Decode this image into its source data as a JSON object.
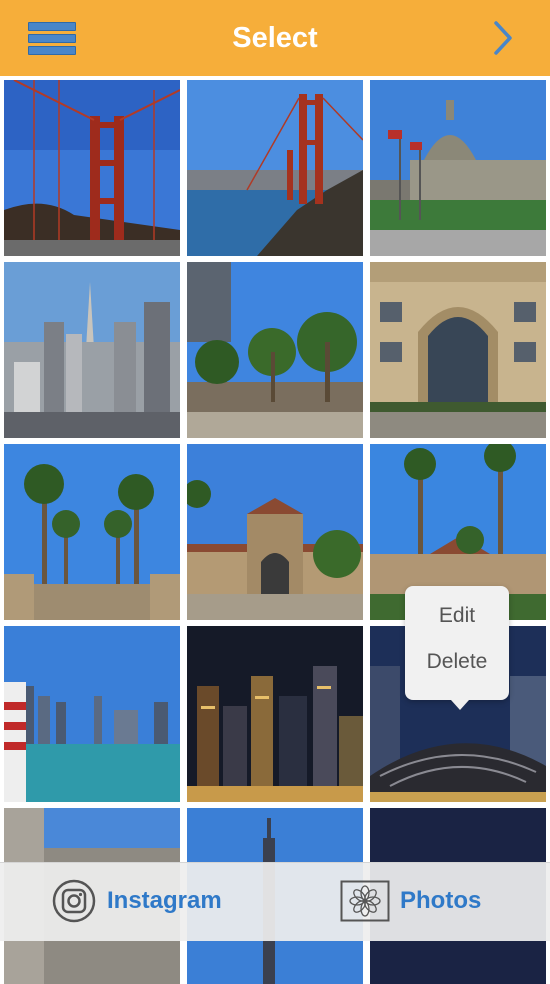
{
  "header": {
    "title": "Select",
    "menu_icon": "menu-icon",
    "next_icon": "chevron-right-icon"
  },
  "grid": {
    "photos": [
      {
        "subject": "golden-gate-bridge-tower"
      },
      {
        "subject": "golden-gate-bridge-bay"
      },
      {
        "subject": "city-hall-dome"
      },
      {
        "subject": "city-skyline"
      },
      {
        "subject": "palm-plaza"
      },
      {
        "subject": "arched-building"
      },
      {
        "subject": "palm-avenue"
      },
      {
        "subject": "mission-building"
      },
      {
        "subject": "palms-building"
      },
      {
        "subject": "skyline-from-water"
      },
      {
        "subject": "city-at-night"
      },
      {
        "subject": "night-pavilion"
      },
      {
        "subject": "building-partial"
      },
      {
        "subject": "tower-partial"
      },
      {
        "subject": "night-partial"
      }
    ]
  },
  "popover": {
    "edit_label": "Edit",
    "delete_label": "Delete"
  },
  "bottom_bar": {
    "instagram_label": "Instagram",
    "photos_label": "Photos"
  },
  "colors": {
    "accent": "#f6ae3a",
    "link": "#2f79c8",
    "menu_icon": "#4a86c8"
  }
}
